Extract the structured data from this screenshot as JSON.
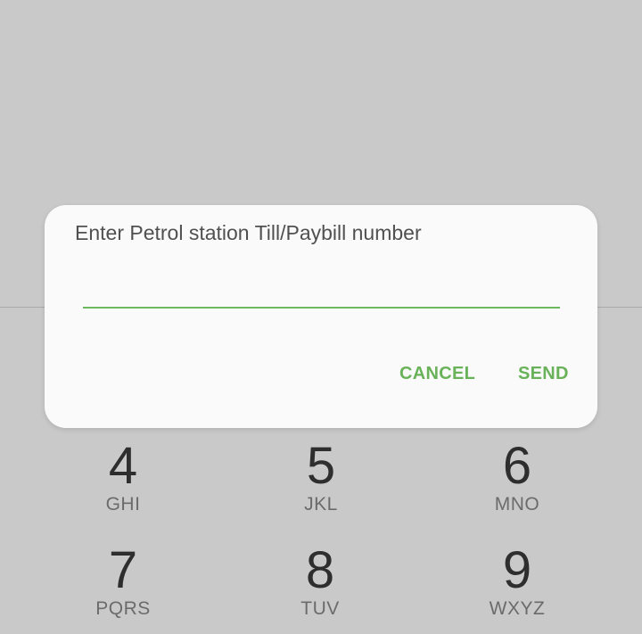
{
  "dialog": {
    "title": "Enter Petrol station Till/Paybill number",
    "input_value": "",
    "input_placeholder": "",
    "cancel_label": "CANCEL",
    "send_label": "SEND",
    "accent_color": "#69b25a"
  },
  "keypad": {
    "keys": [
      {
        "digit": "4",
        "letters": "GHI"
      },
      {
        "digit": "5",
        "letters": "JKL"
      },
      {
        "digit": "6",
        "letters": "MNO"
      },
      {
        "digit": "7",
        "letters": "PQRS"
      },
      {
        "digit": "8",
        "letters": "TUV"
      },
      {
        "digit": "9",
        "letters": "WXYZ"
      }
    ]
  }
}
